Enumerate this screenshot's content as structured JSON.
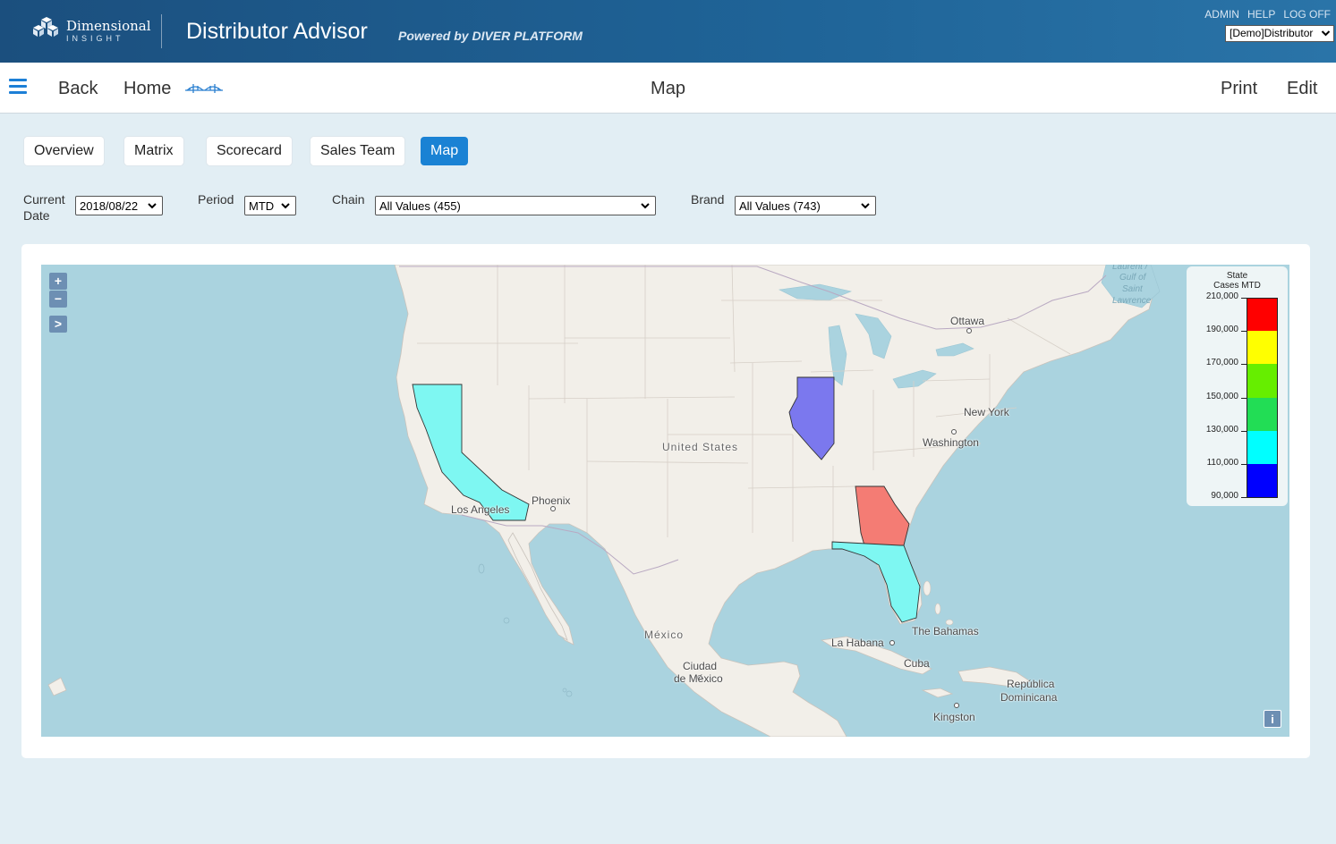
{
  "header": {
    "logo_line1": "Dimensional",
    "logo_line2": "INSIGHT",
    "app_title": "Distributor Advisor",
    "powered_by": "Powered by DIVER PLATFORM",
    "links": {
      "admin": "ADMIN",
      "help": "HELP",
      "logoff": "LOG OFF"
    },
    "tenant": "[Demo]Distributor"
  },
  "nav": {
    "back": "Back",
    "home": "Home",
    "page_title": "Map",
    "print": "Print",
    "edit": "Edit"
  },
  "tabs": [
    "Overview",
    "Matrix",
    "Scorecard",
    "Sales Team",
    "Map"
  ],
  "active_tab": "Map",
  "filters": {
    "current_date": {
      "label_line1": "Current",
      "label_line2": "Date",
      "value": "2018/08/22"
    },
    "period": {
      "label": "Period",
      "value": "MTD"
    },
    "chain": {
      "label": "Chain",
      "value": "All Values (455)"
    },
    "brand": {
      "label": "Brand",
      "value": "All Values (743)"
    }
  },
  "map": {
    "zoom_in": "+",
    "zoom_out": "−",
    "expand": ">",
    "info": "i",
    "labels": {
      "ottawa": "Ottawa",
      "new_york": "New York",
      "washington": "Washington",
      "united_states": "United States",
      "phoenix": "Phoenix",
      "los_angeles": "Los Angeles",
      "mexico": "México",
      "mexico_city_1": "Ciudad",
      "mexico_city_2": "de México",
      "la_habana": "La Habana",
      "cuba": "Cuba",
      "bahamas": "The Bahamas",
      "dominicana_1": "República",
      "dominicana_2": "Dominicana",
      "kingston": "Kingston",
      "gulf_1": "Laurent /",
      "gulf_2": "Gulf of",
      "gulf_3": "Saint",
      "gulf_4": "Lawrence"
    },
    "states": [
      {
        "name": "California",
        "color": "#7ef7f2"
      },
      {
        "name": "Illinois",
        "color": "#7b78ee"
      },
      {
        "name": "Georgia",
        "color": "#f47c74"
      },
      {
        "name": "Florida",
        "color": "#7ef7f2"
      }
    ],
    "legend": {
      "title_line1": "State",
      "title_line2": "Cases MTD",
      "ticks": [
        "210,000",
        "190,000",
        "170,000",
        "150,000",
        "130,000",
        "110,000",
        "90,000"
      ],
      "colors": [
        "#ff0000",
        "#ffff00",
        "#66ee00",
        "#22dd55",
        "#00ffff",
        "#0000ff"
      ]
    }
  }
}
